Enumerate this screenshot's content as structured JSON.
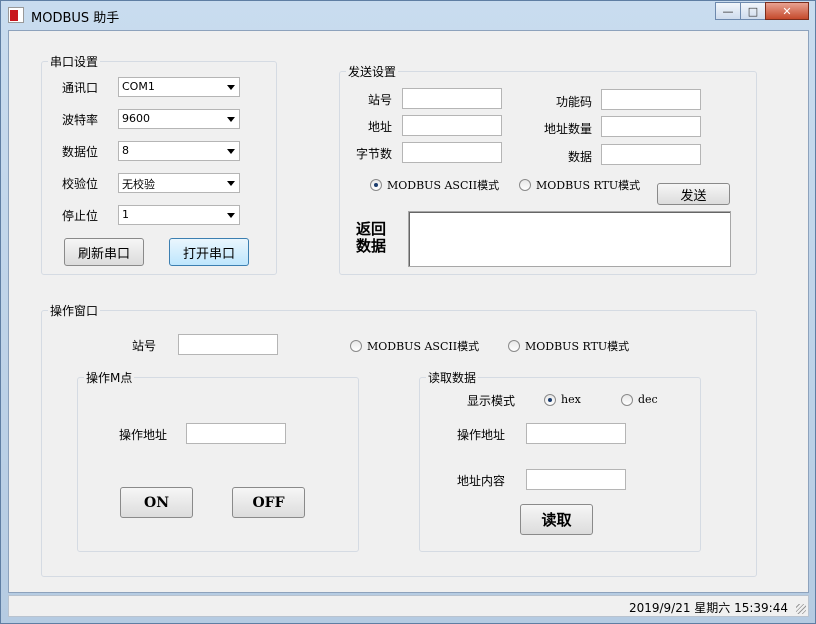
{
  "window": {
    "title": "MODBUS 助手",
    "minimize": "—",
    "maximize": "□",
    "close": "✕"
  },
  "serial": {
    "group_label": "串口设置",
    "port_label": "通讯口",
    "port_value": "COM1",
    "baud_label": "波特率",
    "baud_value": "9600",
    "databits_label": "数据位",
    "databits_value": "8",
    "parity_label": "校验位",
    "parity_value": "无校验",
    "stopbits_label": "停止位",
    "stopbits_value": "1",
    "refresh_button": "刷新串口",
    "open_button": "打开串口"
  },
  "send": {
    "group_label": "发送设置",
    "station_label": "站号",
    "address_label": "地址",
    "bytes_label": "字节数",
    "function_label": "功能码",
    "address_count_label": "地址数量",
    "data_label": "数据",
    "ascii_label": "MODBUS ASCII模式",
    "rtu_label": "MODBUS RTU模式",
    "selected_mode": "ascii",
    "send_button": "发送",
    "return_label": "返回数据"
  },
  "operation": {
    "group_label": "操作窗口",
    "station_label": "站号",
    "ascii_label": "MODBUS ASCII模式",
    "rtu_label": "MODBUS RTU模式",
    "mpoint": {
      "group_label": "操作M点",
      "address_label": "操作地址",
      "on_button": "ON",
      "off_button": "OFF"
    },
    "read": {
      "group_label": "读取数据",
      "display_mode_label": "显示模式",
      "hex_label": "hex",
      "dec_label": "dec",
      "selected_display": "hex",
      "address_label": "操作地址",
      "content_label": "地址内容",
      "read_button": "读取"
    }
  },
  "status": {
    "datetime": "2019/9/21 星期六 15:39:44"
  }
}
